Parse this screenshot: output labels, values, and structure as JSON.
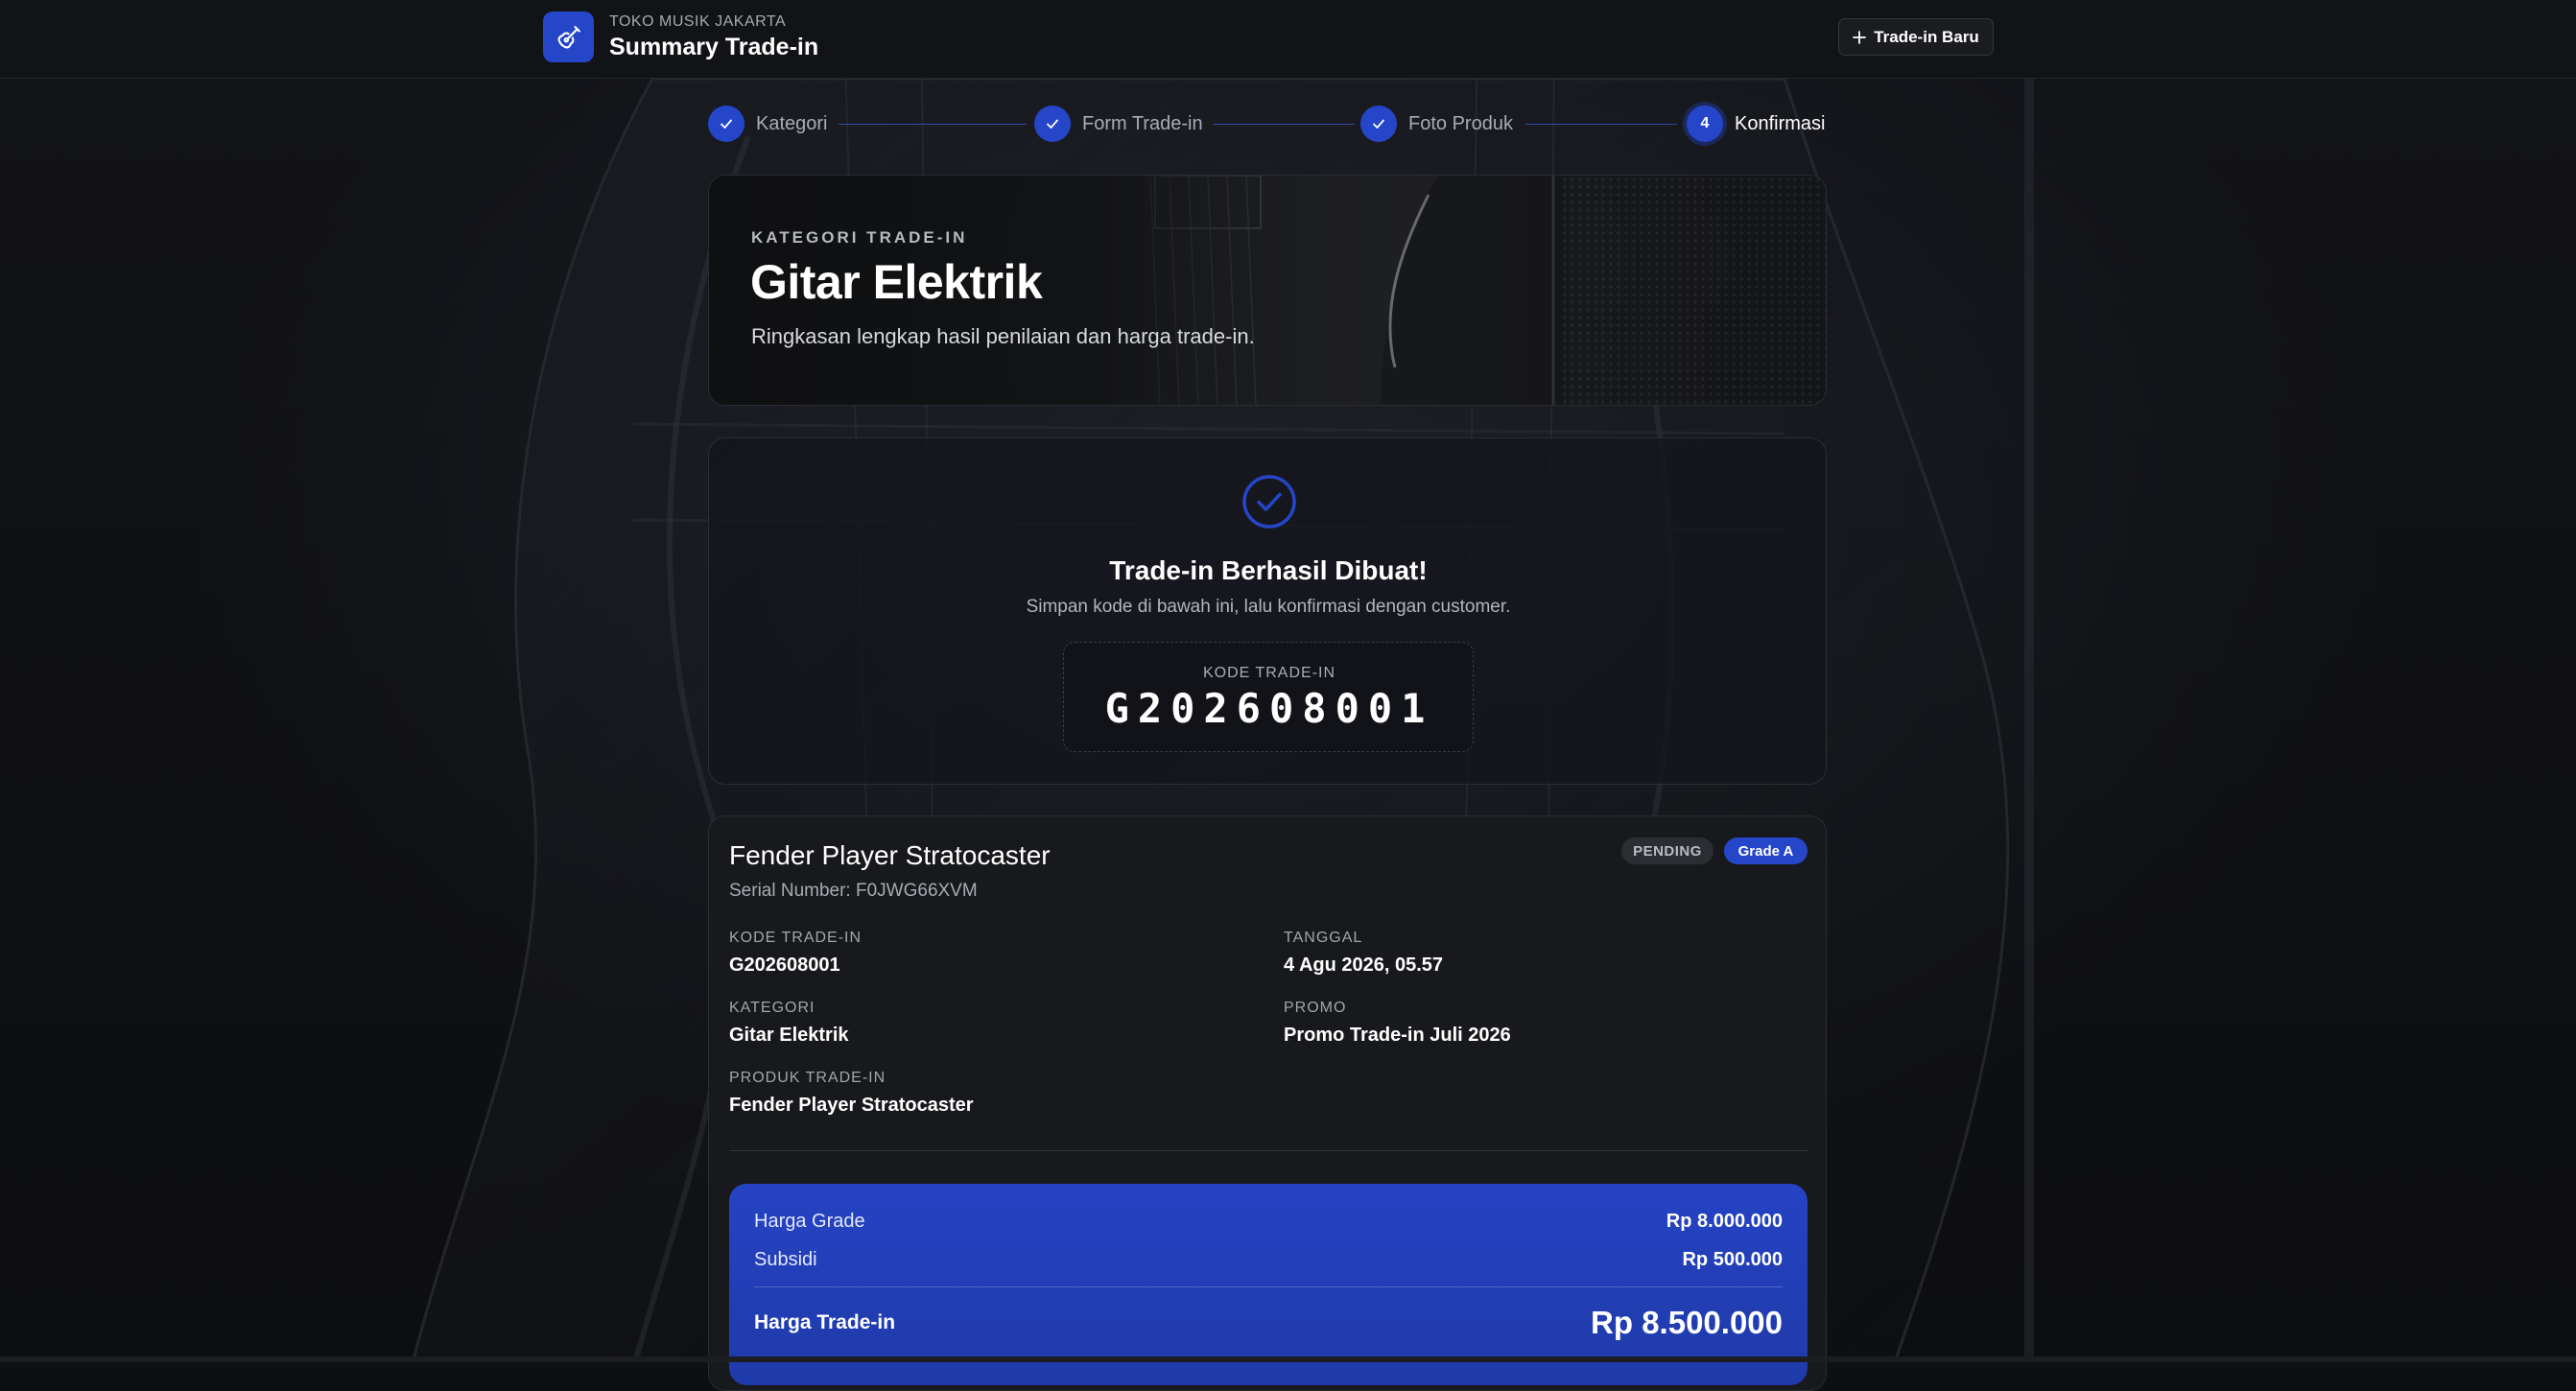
{
  "header": {
    "store_name": "TOKO MUSIK JAKARTA",
    "page_title": "Summary Trade-in",
    "new_button_label": "Trade-in Baru",
    "brand_icon": "guitar-icon"
  },
  "stepper": {
    "steps": [
      {
        "label": "Kategori",
        "state": "done"
      },
      {
        "label": "Form Trade-in",
        "state": "done"
      },
      {
        "label": "Foto Produk",
        "state": "done"
      },
      {
        "label": "Konfirmasi",
        "state": "active",
        "number": "4"
      }
    ]
  },
  "hero": {
    "kicker": "KATEGORI TRADE-IN",
    "title": "Gitar Elektrik",
    "subtitle": "Ringkasan lengkap hasil penilaian dan harga trade-in."
  },
  "success": {
    "title": "Trade-in Berhasil Dibuat!",
    "subtitle": "Simpan kode di bawah ini, lalu konfirmasi dengan customer.",
    "code_label": "KODE TRADE-IN",
    "code_value": "G202608001"
  },
  "detail": {
    "product_name": "Fender Player Stratocaster",
    "serial": "Serial Number: F0JWG66XVM",
    "status_badge": "PENDING",
    "grade_badge": "Grade A",
    "fields": {
      "kode": {
        "label": "KODE TRADE-IN",
        "value": "G202608001"
      },
      "tanggal": {
        "label": "TANGGAL",
        "value": "4 Agu 2026, 05.57"
      },
      "kategori": {
        "label": "KATEGORI",
        "value": "Gitar Elektrik"
      },
      "promo": {
        "label": "PROMO",
        "value": "Promo Trade-in Juli 2026"
      },
      "produk": {
        "label": "PRODUK TRADE-IN",
        "value": "Fender Player Stratocaster"
      }
    },
    "pricing": {
      "grade_label": "Harga Grade",
      "grade_value": "Rp 8.000.000",
      "subsidy_label": "Subsidi",
      "subsidy_value": "Rp 500.000",
      "total_label": "Harga Trade-in",
      "total_value": "Rp 8.500.000"
    }
  },
  "colors": {
    "accent": "#2546c9",
    "background": "#0e0f11",
    "card": "#18191c"
  }
}
